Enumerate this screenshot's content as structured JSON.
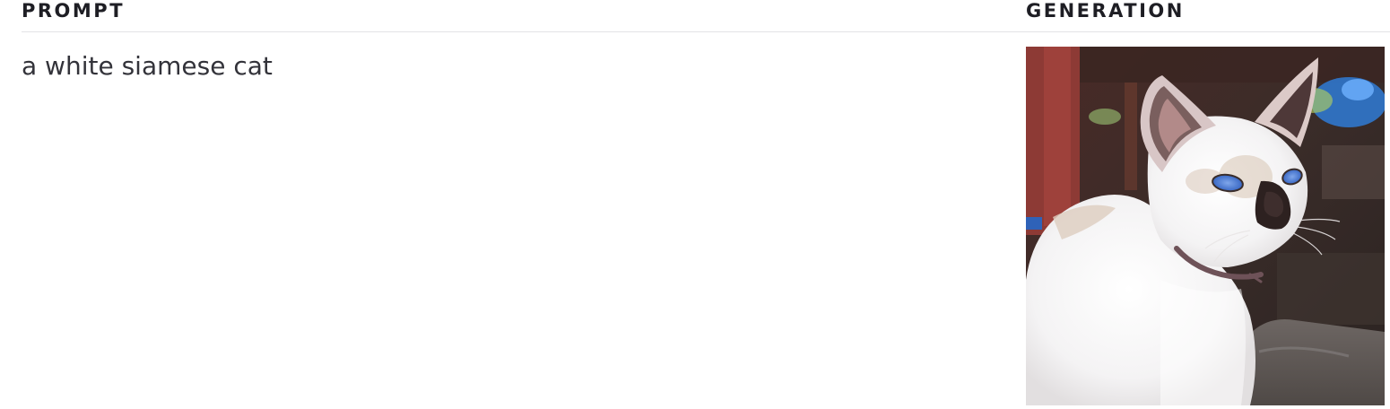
{
  "table": {
    "headers": {
      "prompt": "PROMPT",
      "generation": "GENERATION"
    },
    "rows": [
      {
        "prompt": "a white siamese cat",
        "generation_image": {
          "icon": "generated-cat-image",
          "alt": ""
        }
      }
    ]
  },
  "colors": {
    "text": "#33333a",
    "header_text": "#1e1e24",
    "divider": "#e3e3e6",
    "background": "#ffffff"
  }
}
